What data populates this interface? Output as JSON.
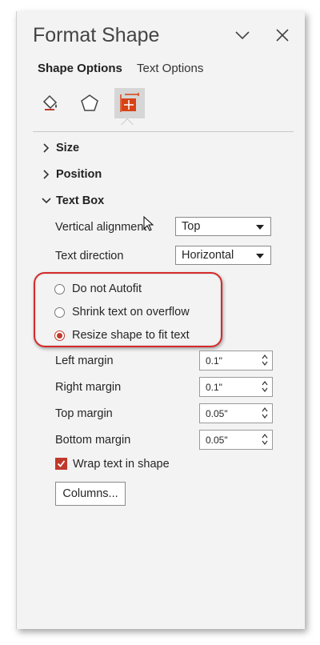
{
  "pane": {
    "title": "Format Shape",
    "tabs": [
      {
        "label": "Shape Options",
        "active": true
      },
      {
        "label": "Text Options",
        "active": false
      }
    ],
    "icons": [
      "fill-line-icon",
      "effects-icon",
      "size-properties-icon"
    ],
    "accent_color": "#c0392b"
  },
  "sections": {
    "size": "Size",
    "position": "Position",
    "text_box": "Text Box"
  },
  "text_box": {
    "vertical_alignment": {
      "label": "Vertical alignment",
      "value": "Top"
    },
    "text_direction": {
      "label": "Text direction",
      "value": "Horizontal"
    },
    "autofit": [
      {
        "label": "Do not Autofit",
        "checked": false
      },
      {
        "label": "Shrink text on overflow",
        "checked": false
      },
      {
        "label": "Resize shape to fit text",
        "checked": true
      }
    ],
    "margins": [
      {
        "label": "Left margin",
        "value": "0.1\""
      },
      {
        "label": "Right margin",
        "value": "0.1\""
      },
      {
        "label": "Top margin",
        "value": "0.05\""
      },
      {
        "label": "Bottom margin",
        "value": "0.05\""
      }
    ],
    "wrap_text": {
      "label": "Wrap text in shape",
      "checked": true
    },
    "columns_button": "Columns..."
  }
}
